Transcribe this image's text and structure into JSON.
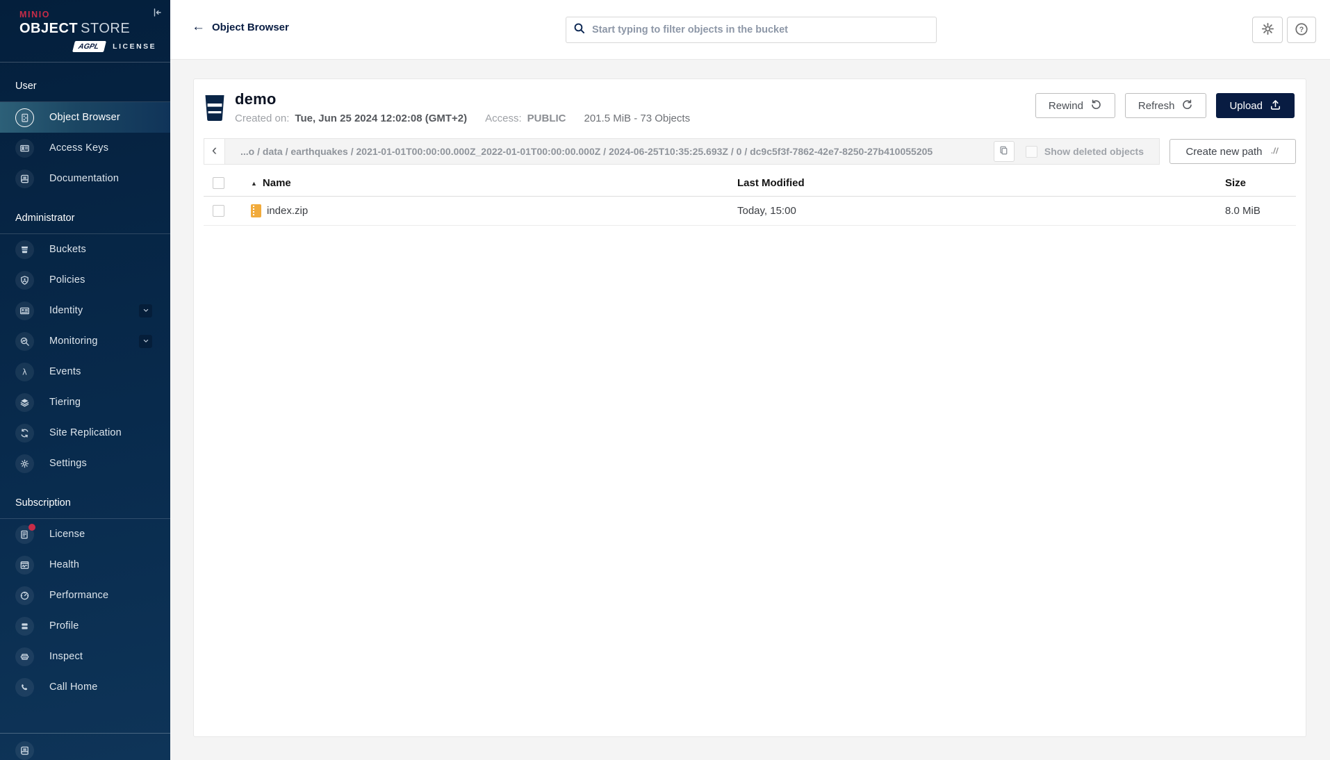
{
  "colors": {
    "accent_red": "#C72C48",
    "navy": "#081C42",
    "sidebar_top": "#041F3C",
    "sidebar_bottom": "#0E3458"
  },
  "brand": {
    "name": "MINIO",
    "product_bold": "OBJECT",
    "product_light": "STORE",
    "license_badge": "AGPL",
    "license_text": "LICENSE"
  },
  "sidebar": {
    "sections": [
      {
        "label": "User",
        "items": [
          {
            "label": "Object Browser",
            "icon": "object-browser-icon",
            "active": true
          },
          {
            "label": "Access Keys",
            "icon": "access-keys-icon"
          },
          {
            "label": "Documentation",
            "icon": "documentation-icon"
          }
        ]
      },
      {
        "label": "Administrator",
        "items": [
          {
            "label": "Buckets",
            "icon": "buckets-icon"
          },
          {
            "label": "Policies",
            "icon": "policies-icon"
          },
          {
            "label": "Identity",
            "icon": "identity-icon",
            "expandable": true
          },
          {
            "label": "Monitoring",
            "icon": "monitoring-icon",
            "expandable": true
          },
          {
            "label": "Events",
            "icon": "events-icon"
          },
          {
            "label": "Tiering",
            "icon": "tiering-icon"
          },
          {
            "label": "Site Replication",
            "icon": "site-replication-icon"
          },
          {
            "label": "Settings",
            "icon": "settings-icon"
          }
        ]
      },
      {
        "label": "Subscription",
        "items": [
          {
            "label": "License",
            "icon": "license-icon",
            "badge": true
          },
          {
            "label": "Health",
            "icon": "health-icon"
          },
          {
            "label": "Performance",
            "icon": "performance-icon"
          },
          {
            "label": "Profile",
            "icon": "profile-icon"
          },
          {
            "label": "Inspect",
            "icon": "inspect-icon"
          },
          {
            "label": "Call Home",
            "icon": "call-home-icon"
          }
        ]
      }
    ]
  },
  "header": {
    "title": "Object Browser",
    "search_placeholder": "Start typing to filter objects in the bucket"
  },
  "bucket": {
    "name": "demo",
    "created_label": "Created on:",
    "created_value": "Tue, Jun 25 2024 12:02:08 (GMT+2)",
    "access_label": "Access:",
    "access_value": "PUBLIC",
    "usage": "201.5 MiB - 73 Objects"
  },
  "actions": {
    "rewind": "Rewind",
    "refresh": "Refresh",
    "upload": "Upload",
    "create_path": "Create new path",
    "show_deleted": "Show deleted objects"
  },
  "breadcrumb": {
    "path": "...o / data / earthquakes / 2021-01-01T00:00:00.000Z_2022-01-01T00:00:00.000Z / 2024-06-25T10:35:25.693Z / 0 / dc9c5f3f-7862-42e7-8250-27b410055205"
  },
  "table": {
    "columns": [
      "Name",
      "Last Modified",
      "Size"
    ],
    "rows": [
      {
        "name": "index.zip",
        "modified": "Today, 15:00",
        "size": "8.0 MiB",
        "icon": "zip-file-icon"
      }
    ]
  }
}
